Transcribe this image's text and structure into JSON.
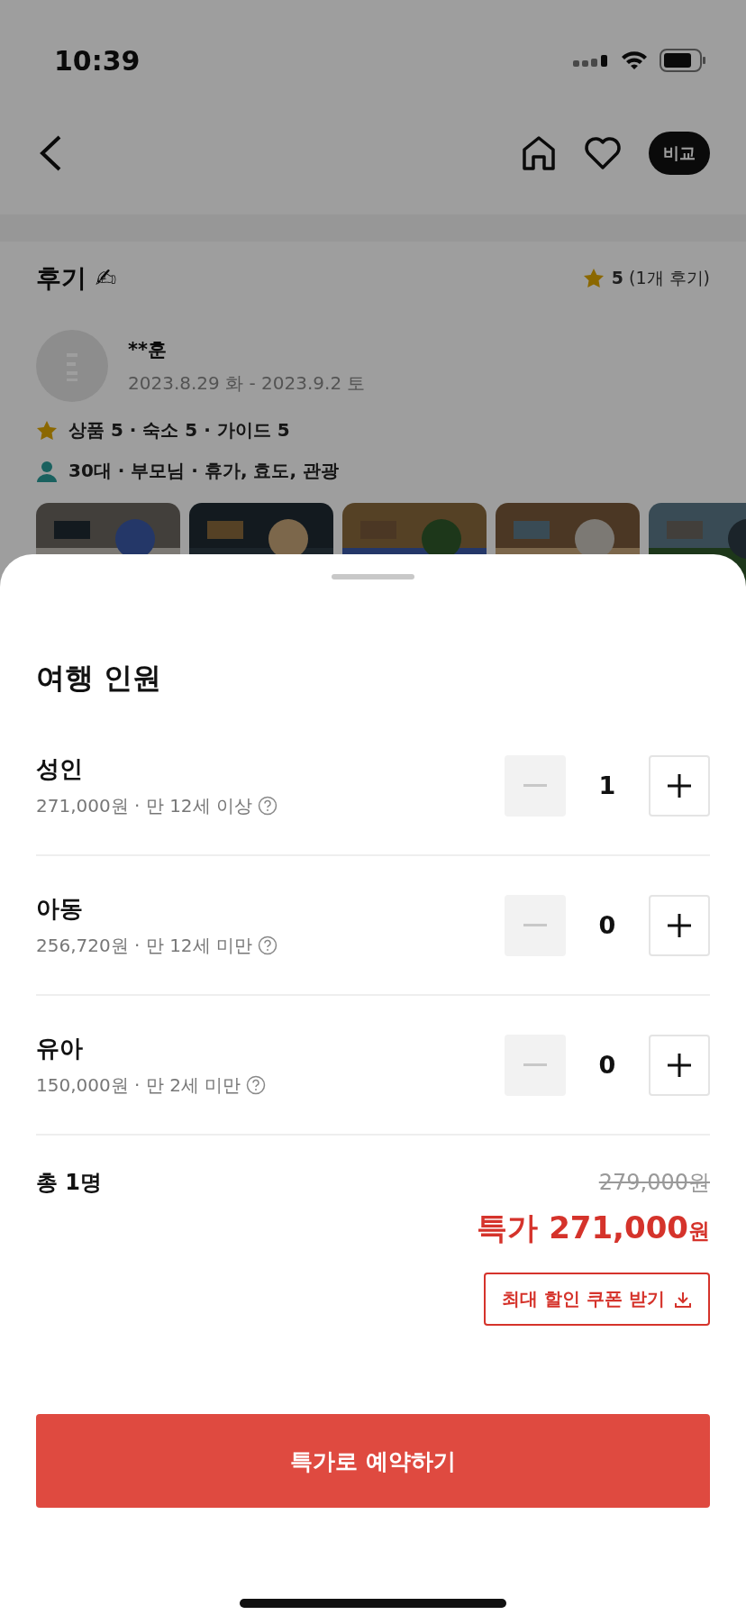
{
  "status_bar": {
    "time": "10:39"
  },
  "nav": {
    "compare_label": "비교"
  },
  "review": {
    "title": "후기 ✍",
    "summary": "**5** (1개 후기)",
    "author": "**훈",
    "dates": "2023.8.29 화 - 2023.9.2 토",
    "ratings": "상품 5 · 숙소 5 · 가이드 5",
    "traveler": "30대 · 부모님 · 휴가, 효도, 관광"
  },
  "sheet": {
    "title": "여행 인원",
    "rows": [
      {
        "label": "성인",
        "detail": "271,000원 · 만 12세 이상",
        "count": "1",
        "minus_disabled": true
      },
      {
        "label": "아동",
        "detail": "256,720원 · 만 12세 미만",
        "count": "0",
        "minus_disabled": true
      },
      {
        "label": "유아",
        "detail": "150,000원 · 만 2세 미만",
        "count": "0",
        "minus_disabled": true
      }
    ],
    "total_label": "총 1명",
    "original_price": "279,000원",
    "sale_label": "특가",
    "sale_amount": "271,000",
    "sale_unit": "원",
    "coupon_button": "최대 할인 쿠폰 받기",
    "book_button": "특가로 예약하기"
  }
}
